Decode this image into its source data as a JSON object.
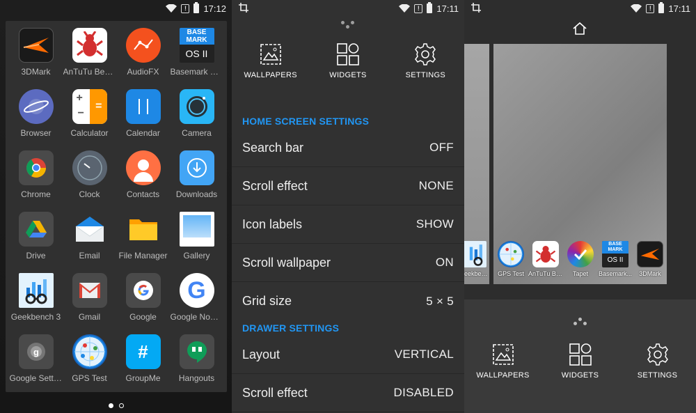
{
  "status_left": {
    "time": "17:12"
  },
  "status_mid": {
    "time": "17:11"
  },
  "status_right": {
    "time": "17:11"
  },
  "drawer": {
    "apps": [
      {
        "label": "3DMark",
        "icon": "3dmark-icon"
      },
      {
        "label": "AnTuTu Bench...",
        "icon": "antutu-icon"
      },
      {
        "label": "AudioFX",
        "icon": "audiofx-icon"
      },
      {
        "label": "Basemark OS...",
        "icon": "basemark-icon"
      },
      {
        "label": "Browser",
        "icon": "browser-icon"
      },
      {
        "label": "Calculator",
        "icon": "calculator-icon"
      },
      {
        "label": "Calendar",
        "icon": "calendar-icon"
      },
      {
        "label": "Camera",
        "icon": "camera-icon"
      },
      {
        "label": "Chrome",
        "icon": "chrome-icon"
      },
      {
        "label": "Clock",
        "icon": "clock-icon"
      },
      {
        "label": "Contacts",
        "icon": "contacts-icon"
      },
      {
        "label": "Downloads",
        "icon": "downloads-icon"
      },
      {
        "label": "Drive",
        "icon": "drive-icon"
      },
      {
        "label": "Email",
        "icon": "email-icon"
      },
      {
        "label": "File Manager",
        "icon": "file-manager-icon"
      },
      {
        "label": "Gallery",
        "icon": "gallery-icon"
      },
      {
        "label": "Geekbench 3",
        "icon": "geekbench-icon"
      },
      {
        "label": "Gmail",
        "icon": "gmail-icon"
      },
      {
        "label": "Google",
        "icon": "google-icon"
      },
      {
        "label": "Google Now L...",
        "icon": "google-now-icon"
      },
      {
        "label": "Google Settin...",
        "icon": "google-settings-icon"
      },
      {
        "label": "GPS Test",
        "icon": "gps-test-icon"
      },
      {
        "label": "GroupMe",
        "icon": "groupme-icon"
      },
      {
        "label": "Hangouts",
        "icon": "hangouts-icon"
      }
    ],
    "basemark_text_top": "BASE MARK",
    "basemark_text_bottom": "OS II"
  },
  "settings": {
    "tools": [
      {
        "label": "WALLPAPERS"
      },
      {
        "label": "WIDGETS"
      },
      {
        "label": "SETTINGS"
      }
    ],
    "home_section": "HOME SCREEN SETTINGS",
    "home_rows": [
      {
        "label": "Search bar",
        "value": "OFF"
      },
      {
        "label": "Scroll effect",
        "value": "NONE"
      },
      {
        "label": "Icon labels",
        "value": "SHOW"
      },
      {
        "label": "Scroll wallpaper",
        "value": "ON"
      },
      {
        "label": "Grid size",
        "value": "5 × 5"
      }
    ],
    "drawer_section": "DRAWER SETTINGS",
    "drawer_rows": [
      {
        "label": "Layout",
        "value": "VERTICAL"
      },
      {
        "label": "Scroll effect",
        "value": "DISABLED"
      }
    ]
  },
  "overview": {
    "left_page_label": "eekbench...",
    "dock": [
      {
        "label": "GPS Test"
      },
      {
        "label": "AnTuTu Be..."
      },
      {
        "label": "Tapet"
      },
      {
        "label": "Basemark..."
      },
      {
        "label": "3DMark"
      }
    ],
    "tools": [
      {
        "label": "WALLPAPERS"
      },
      {
        "label": "WIDGETS"
      },
      {
        "label": "SETTINGS"
      }
    ]
  },
  "colors": {
    "accent": "#2196f3",
    "panel": "#313131",
    "drawer": "#303030"
  }
}
